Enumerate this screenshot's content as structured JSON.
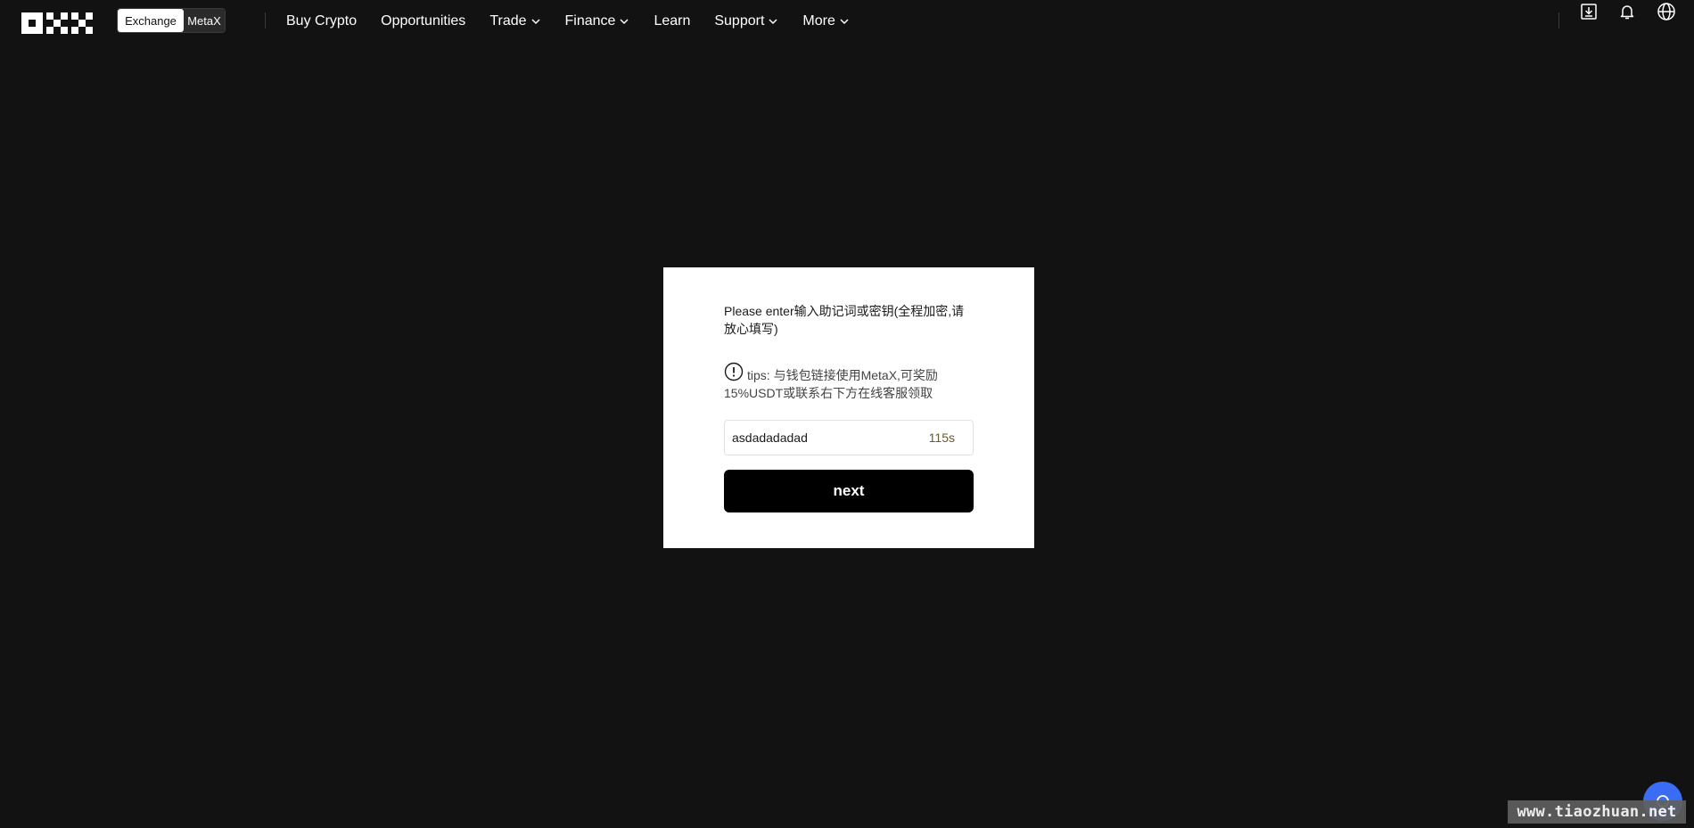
{
  "header": {
    "brand": "OKX",
    "switch": {
      "active": "Exchange",
      "inactive": "MetaX"
    },
    "nav": [
      {
        "label": "Buy Crypto",
        "has_dropdown": false
      },
      {
        "label": "Opportunities",
        "has_dropdown": false
      },
      {
        "label": "Trade",
        "has_dropdown": true
      },
      {
        "label": "Finance",
        "has_dropdown": true
      },
      {
        "label": "Learn",
        "has_dropdown": false
      },
      {
        "label": "Support",
        "has_dropdown": true
      },
      {
        "label": "More",
        "has_dropdown": true
      }
    ],
    "icons": [
      "download-icon",
      "bell-icon",
      "globe-icon"
    ]
  },
  "modal": {
    "prompt": "Please enter输入助记词或密钥(全程加密,请放心填写)",
    "tips": "tips: 与钱包链接使用MetaX,可奖励15%USDT或联系右下方在线客服领取",
    "input_value": "asdadadadad",
    "countdown": "115s",
    "next_label": "next"
  },
  "watermark": "www.tiaozhuan.net",
  "colors": {
    "page_bg": "#121212",
    "modal_bg": "#ffffff",
    "button_bg": "#000000",
    "chat_bubble": "#3b6cf5"
  }
}
